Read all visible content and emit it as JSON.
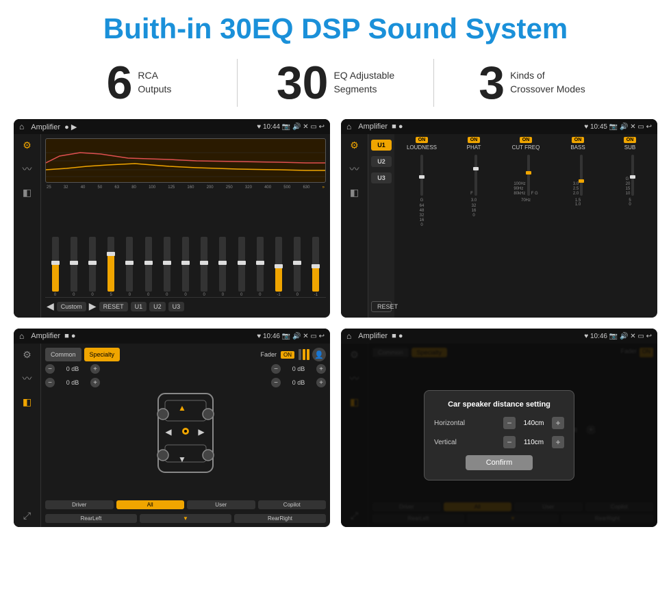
{
  "page": {
    "title": "Buith-in 30EQ DSP Sound System",
    "stats": [
      {
        "number": "6",
        "label": "RCA\nOutputs"
      },
      {
        "number": "30",
        "label": "EQ Adjustable\nSegments"
      },
      {
        "number": "3",
        "label": "Kinds of\nCrossover Modes"
      }
    ]
  },
  "screens": [
    {
      "id": "eq-screen",
      "statusbar": {
        "title": "Amplifier",
        "time": "10:44",
        "dots": [
          "gray",
          "play"
        ]
      }
    },
    {
      "id": "crossover-screen",
      "statusbar": {
        "title": "Amplifier",
        "time": "10:45",
        "dots": [
          "square",
          "dot"
        ]
      }
    },
    {
      "id": "speaker-screen",
      "statusbar": {
        "title": "Amplifier",
        "time": "10:46",
        "dots": [
          "square",
          "dot"
        ]
      }
    },
    {
      "id": "dialog-screen",
      "statusbar": {
        "title": "Amplifier",
        "time": "10:46",
        "dots": [
          "square",
          "dot"
        ]
      },
      "dialog": {
        "title": "Car speaker distance setting",
        "horizontal_label": "Horizontal",
        "horizontal_value": "140cm",
        "vertical_label": "Vertical",
        "vertical_value": "110cm",
        "confirm_label": "Confirm"
      }
    }
  ],
  "eq": {
    "frequencies": [
      "25",
      "32",
      "40",
      "50",
      "63",
      "80",
      "100",
      "125",
      "160",
      "200",
      "250",
      "320",
      "400",
      "500",
      "630"
    ],
    "values": [
      "0",
      "0",
      "0",
      "5",
      "0",
      "0",
      "0",
      "0",
      "0",
      "0",
      "0",
      "0",
      "-1",
      "0",
      "-1"
    ],
    "preset": "Custom",
    "buttons": [
      "RESET",
      "U1",
      "U2",
      "U3"
    ]
  },
  "crossover": {
    "u_buttons": [
      "U1",
      "U2",
      "U3"
    ],
    "channels": [
      {
        "label": "LOUDNESS",
        "on": true
      },
      {
        "label": "PHAT",
        "on": true
      },
      {
        "label": "CUT FREQ",
        "on": true
      },
      {
        "label": "BASS",
        "on": true
      },
      {
        "label": "SUB",
        "on": true
      }
    ],
    "reset_label": "RESET"
  },
  "speaker": {
    "tabs": [
      "Common",
      "Specialty"
    ],
    "active_tab": "Specialty",
    "fader_label": "Fader",
    "fader_on": "ON",
    "db_values": [
      "0 dB",
      "0 dB",
      "0 dB",
      "0 dB"
    ],
    "bottom_btns": [
      "Driver",
      "All",
      "User",
      "Copilot",
      "RearLeft",
      "RearRight"
    ]
  },
  "dialog": {
    "title": "Car speaker distance setting",
    "horizontal_label": "Horizontal",
    "horizontal_value": "140cm",
    "vertical_label": "Vertical",
    "vertical_value": "110cm",
    "confirm_label": "Confirm"
  }
}
